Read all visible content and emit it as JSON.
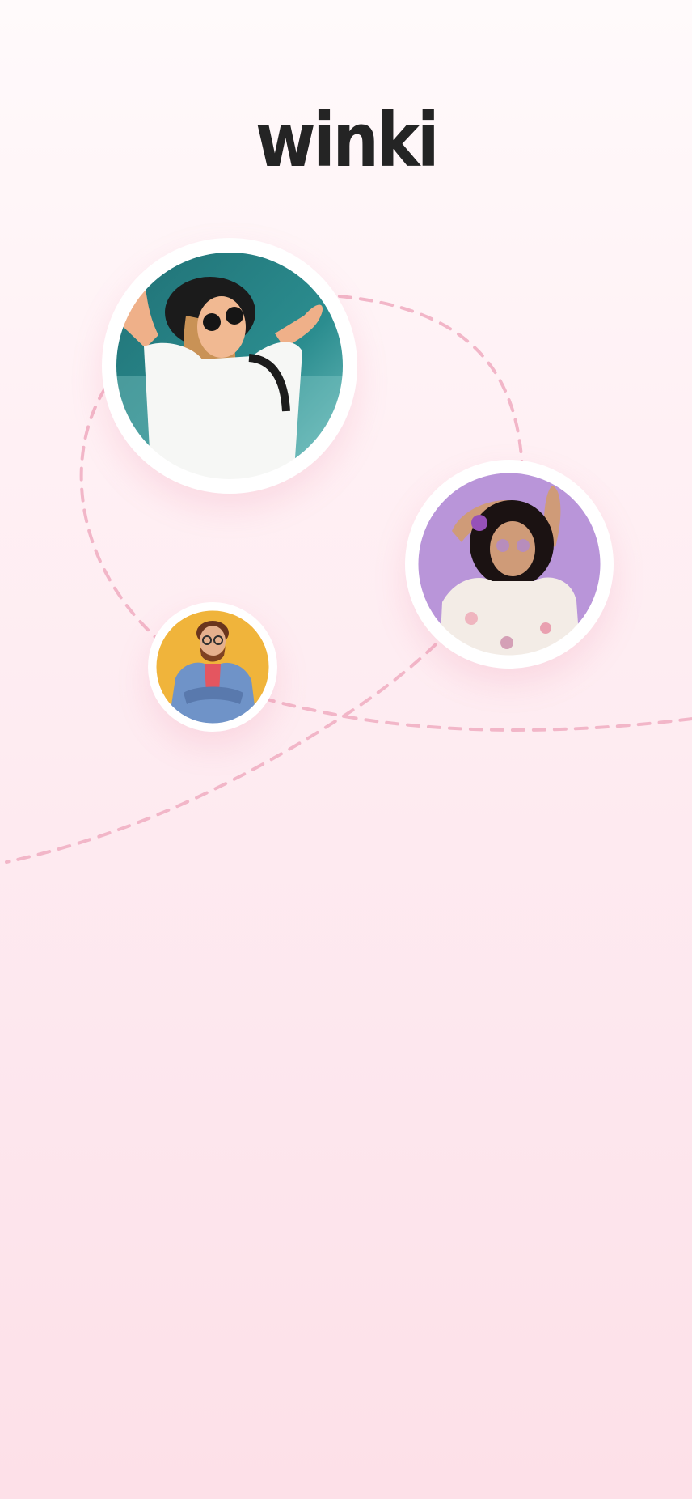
{
  "brand": {
    "logo_text": "winki"
  },
  "profiles": [
    {
      "icon": "woman-with-hat-and-sunglasses-photo"
    },
    {
      "icon": "woman-with-curly-hair-photo"
    },
    {
      "icon": "man-in-denim-jacket-photo"
    }
  ],
  "colors": {
    "background_top": "#fffafb",
    "background_bottom": "#fde0e8",
    "connector_dash": "#f2b6c8",
    "logo": "#242424"
  }
}
